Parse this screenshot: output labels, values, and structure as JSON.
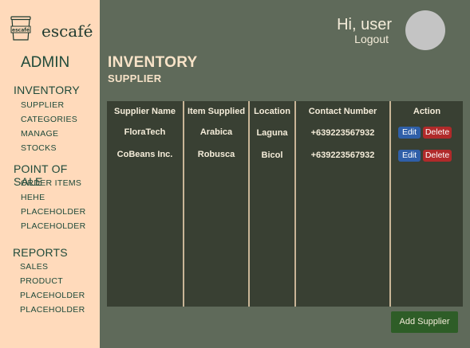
{
  "brand": {
    "logo_text": "escafé",
    "name": "escafé"
  },
  "sidebar": {
    "title": "ADMIN",
    "sections": [
      {
        "label": "INVENTORY",
        "items": [
          "SUPPLIER",
          "CATEGORIES",
          "MANAGE",
          "STOCKS"
        ]
      },
      {
        "label": "POINT OF SALE",
        "items": [
          "ORDER ITEMS",
          "HEHE",
          "PLACEHOLDER",
          "PLACEHOLDER"
        ]
      },
      {
        "label": "REPORTS",
        "items": [
          "SALES",
          "PRODUCT",
          "PLACEHOLDER",
          "PLACEHOLDER"
        ]
      }
    ]
  },
  "header": {
    "greeting": "Hi, user",
    "logout": "Logout"
  },
  "page": {
    "title": "INVENTORY",
    "subtitle": "SUPPLIER"
  },
  "table": {
    "columns": [
      "Supplier Name",
      "Item Supplied",
      "Location",
      "Contact Number",
      "Action"
    ],
    "rows": [
      {
        "supplier": "FloraTech",
        "item": "Arabica",
        "location": "Laguna",
        "contact": "+639223567932"
      },
      {
        "supplier": "CoBeans Inc.",
        "item": "Robusca",
        "location": "Bicol",
        "contact": "+639223567932"
      }
    ],
    "edit_label": "Edit",
    "delete_label": "Delete"
  },
  "add_button": "Add Supplier",
  "colors": {
    "sidebar_bg": "#ffdabb",
    "main_bg": "#5f6a5a",
    "table_bg": "#394033",
    "edit_bg": "#2f5fa8",
    "delete_bg": "#b02a2a",
    "add_bg": "#2e5d27"
  }
}
